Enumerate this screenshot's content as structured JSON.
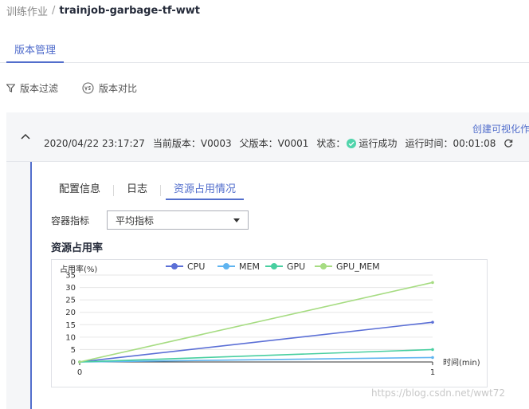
{
  "breadcrumb": {
    "parent": "训练作业",
    "separator": "/",
    "current": "trainjob-garbage-tf-wwt"
  },
  "tabs": {
    "main": "版本管理"
  },
  "toolbar": {
    "filter_label": "版本过滤",
    "compare_label": "版本对比",
    "filter_icon": "filter-icon",
    "compare_icon": "vs-icon"
  },
  "version": {
    "timestamp": "2020/04/22 23:17:27",
    "current_label": "当前版本：",
    "current_value": "V0003",
    "parent_label": "父版本：",
    "parent_value": "V0001",
    "status_label": "状态：",
    "status_value": "运行成功",
    "runtime_label": "运行时间：",
    "runtime_value": "00:01:08",
    "create_link": "创建可视化作"
  },
  "subtabs": [
    "配置信息",
    "日志",
    "资源占用情况"
  ],
  "metric": {
    "label": "容器指标",
    "selected": "平均指标"
  },
  "section_title": "资源占用率",
  "colors": {
    "accent": "#526ecc",
    "success": "#50d4ab"
  },
  "chart_data": {
    "type": "line",
    "x": [
      0,
      1
    ],
    "xlabel": "时间(min)",
    "ylabel": "占用率(%)",
    "ylim": [
      0,
      35
    ],
    "xlim": [
      0,
      1
    ],
    "yticks": [
      0,
      5,
      10,
      15,
      20,
      25,
      30,
      35
    ],
    "xticks": [
      0,
      1
    ],
    "grid": true,
    "legend_position": "top",
    "series": [
      {
        "name": "CPU",
        "values": [
          0,
          16
        ],
        "color": "#5b6fd6"
      },
      {
        "name": "MEM",
        "values": [
          0,
          1.8
        ],
        "color": "#5fb4f0"
      },
      {
        "name": "GPU",
        "values": [
          0,
          5
        ],
        "color": "#48cfa0"
      },
      {
        "name": "GPU_MEM",
        "values": [
          0,
          32
        ],
        "color": "#a6dc82"
      }
    ]
  },
  "watermark": "https://blog.csdn.net/wwt72"
}
